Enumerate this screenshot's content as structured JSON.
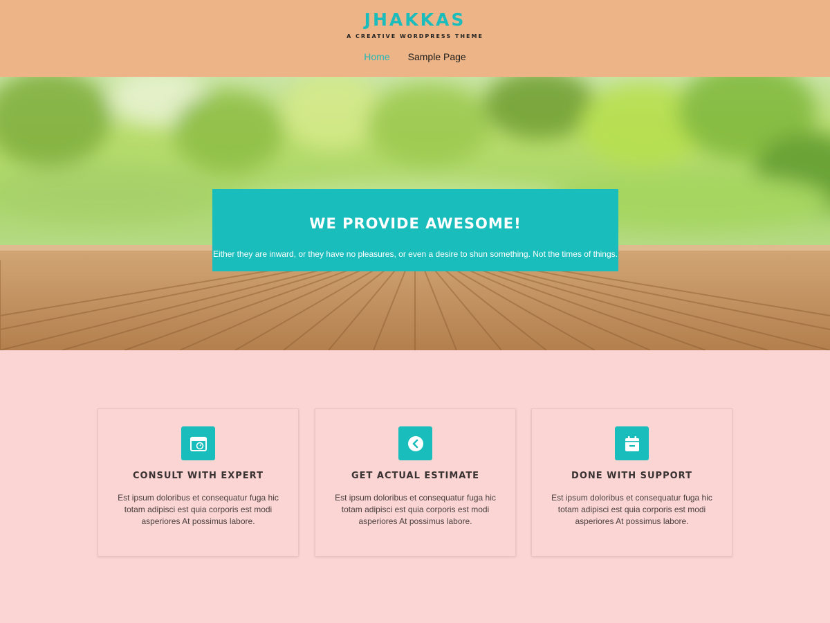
{
  "header": {
    "site_title": "JHAKKAS",
    "tagline": "A CREATIVE WORDPRESS THEME",
    "nav": [
      {
        "label": "Home",
        "active": true
      },
      {
        "label": "Sample Page",
        "active": false
      }
    ]
  },
  "hero": {
    "title": "WE PROVIDE AWESOME!",
    "text": "Either they are inward, or they have no pleasures, or even a desire to shun something. Not the times of things."
  },
  "features": [
    {
      "icon": "calendar-clock-icon",
      "title": "CONSULT WITH EXPERT",
      "text": "Est ipsum doloribus et consequatur fuga hic totam adipisci est quia corporis est modi asperiores At possimus labore."
    },
    {
      "icon": "chevron-left-circle-icon",
      "title": "GET ACTUAL ESTIMATE",
      "text": "Est ipsum doloribus et consequatur fuga hic totam adipisci est quia corporis est modi asperiores At possimus labore."
    },
    {
      "icon": "calendar-minus-icon",
      "title": "DONE WITH SUPPORT",
      "text": "Est ipsum doloribus et consequatur fuga hic totam adipisci est quia corporis est modi asperiores At possimus labore."
    }
  ],
  "colors": {
    "header_bg": "#edb587",
    "accent": "#19bdbc",
    "page_bg": "#fad5d3"
  }
}
